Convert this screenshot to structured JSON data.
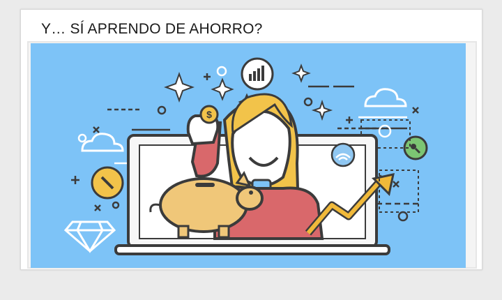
{
  "slide": {
    "title": "Y… SÍ APRENDO DE AHORRO?"
  },
  "illustration": {
    "coin_symbol": "$",
    "colors": {
      "sky": "#7dc3f7",
      "outline": "#3b3b3b",
      "hair": "#f2c34a",
      "sweater": "#d9686b",
      "piggy": "#f0c779",
      "arrow": "#f0b93a",
      "laptop": "#ffffff"
    }
  }
}
